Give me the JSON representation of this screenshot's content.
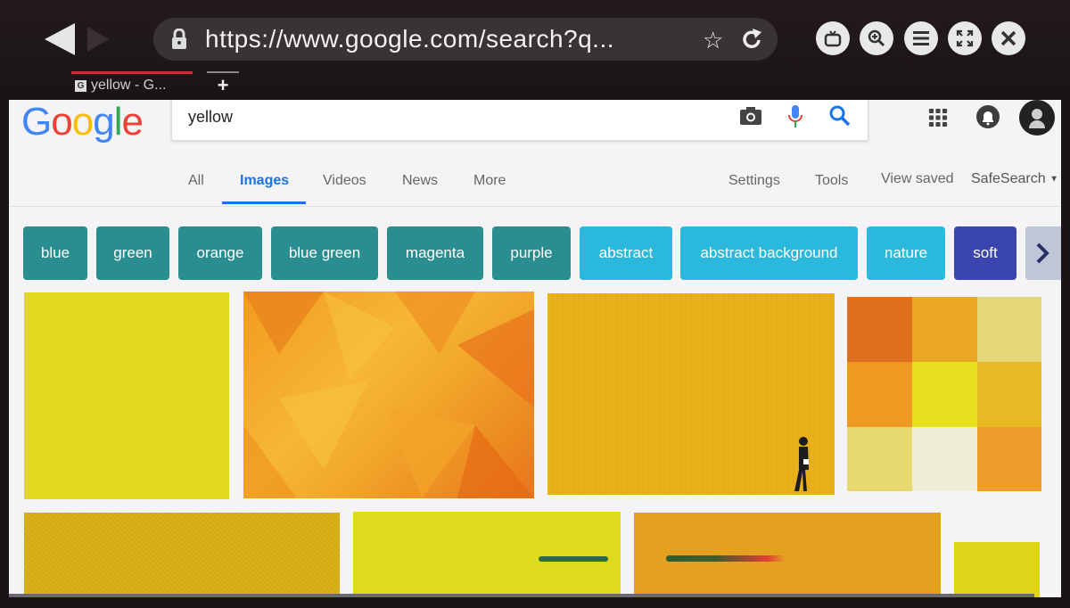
{
  "browser": {
    "url": "https://www.google.com/search?q...",
    "tab_title": "yellow - G...",
    "tab_favicon": "G",
    "new_tab_label": "+",
    "icons": [
      "back-icon",
      "forward-icon",
      "lock-icon",
      "bookmark-star-icon",
      "reload-icon",
      "tv-icon",
      "zoom-icon",
      "menu-icon",
      "fullscreen-icon",
      "close-icon"
    ]
  },
  "google": {
    "logo_letters": [
      {
        "ch": "G",
        "color": "#4285F4"
      },
      {
        "ch": "o",
        "color": "#EA4335"
      },
      {
        "ch": "o",
        "color": "#FBBC05"
      },
      {
        "ch": "g",
        "color": "#4285F4"
      },
      {
        "ch": "l",
        "color": "#34A853"
      },
      {
        "ch": "e",
        "color": "#EA4335"
      }
    ],
    "query": "yellow"
  },
  "nav": {
    "tabs": [
      {
        "label": "All",
        "active": false
      },
      {
        "label": "Images",
        "active": true
      },
      {
        "label": "Videos",
        "active": false
      },
      {
        "label": "News",
        "active": false
      },
      {
        "label": "More",
        "active": false
      }
    ],
    "settings": "Settings",
    "tools": "Tools",
    "view_saved": "View saved",
    "safesearch": "SafeSearch"
  },
  "chips": [
    {
      "label": "blue",
      "color": "#2a8d8f"
    },
    {
      "label": "green",
      "color": "#2a8d8f"
    },
    {
      "label": "orange",
      "color": "#2a8d8f"
    },
    {
      "label": "blue green",
      "color": "#2a8d8f"
    },
    {
      "label": "magenta",
      "color": "#2a8d8f"
    },
    {
      "label": "purple",
      "color": "#2a8d8f"
    },
    {
      "label": "abstract",
      "color": "#2ab8dc"
    },
    {
      "label": "abstract background",
      "color": "#2ab8dc"
    },
    {
      "label": "nature",
      "color": "#2ab8dc"
    },
    {
      "label": "soft",
      "color": "#3b45b0"
    }
  ],
  "colors": {
    "accent_blue": "#1a73e8",
    "page_bg": "#f4f4f6",
    "yellow_swatches": [
      "#e6d81c",
      "#f5a623",
      "#e9b41d",
      "#d8c21a"
    ]
  }
}
